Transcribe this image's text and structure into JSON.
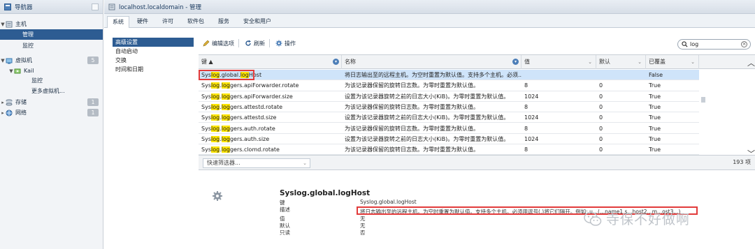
{
  "navigator": {
    "title": "导航器",
    "items": [
      {
        "label": "主机",
        "badge": ""
      },
      {
        "label": "管理",
        "badge": ""
      },
      {
        "label": "监控",
        "badge": ""
      },
      {
        "label": "虚拟机",
        "badge": "5"
      },
      {
        "label": "Kail",
        "badge": ""
      },
      {
        "label": "监控",
        "badge": ""
      },
      {
        "label": "更多虚拟机...",
        "badge": ""
      },
      {
        "label": "存储",
        "badge": "1"
      },
      {
        "label": "网络",
        "badge": "1"
      }
    ]
  },
  "header": {
    "title": "localhost.localdomain - 管理"
  },
  "tabs": [
    {
      "label": "系统"
    },
    {
      "label": "硬件"
    },
    {
      "label": "许可"
    },
    {
      "label": "软件包"
    },
    {
      "label": "服务"
    },
    {
      "label": "安全和用户"
    }
  ],
  "left_menu": [
    {
      "label": "高级设置"
    },
    {
      "label": "自动启动"
    },
    {
      "label": "交换"
    },
    {
      "label": "时间和日期"
    }
  ],
  "toolbar": {
    "edit_label": "编辑选项",
    "refresh_label": "刷新",
    "actions_label": "操作"
  },
  "search": {
    "value": "log",
    "clear_glyph": "×"
  },
  "grid": {
    "columns": [
      {
        "label": "键 ▲"
      },
      {
        "label": "名称"
      },
      {
        "label": "值"
      },
      {
        "label": "默认"
      },
      {
        "label": "已覆盖"
      }
    ],
    "rows": [
      {
        "key_pre": "Sys",
        "key_hl": "log",
        "key_mid": ".global.",
        "key_hl2": "log",
        "key_post": "Host",
        "name": "将日志输出至的远程主机。为空时重置为默认值。支持多个主机。必须...",
        "value": "",
        "default": "",
        "overridden": "False"
      },
      {
        "key_pre": "Sys",
        "key_hl": "log",
        "key_mid": ".",
        "key_hl2": "log",
        "key_post": "gers.apiForwarder.rotate",
        "name": "为该记录器保留的旋转日志数。为零时重置为默认值。",
        "value": "8",
        "default": "0",
        "overridden": "True"
      },
      {
        "key_pre": "Sys",
        "key_hl": "log",
        "key_mid": ".",
        "key_hl2": "log",
        "key_post": "gers.apiForwarder.size",
        "name": "设置为该记录器旋转之前的日志大小(KiB)。为零时重置为默认值。",
        "value": "1024",
        "default": "0",
        "overridden": "True"
      },
      {
        "key_pre": "Sys",
        "key_hl": "log",
        "key_mid": ".",
        "key_hl2": "log",
        "key_post": "gers.attestd.rotate",
        "name": "为该记录器保留的旋转日志数。为零时重置为默认值。",
        "value": "8",
        "default": "0",
        "overridden": "True"
      },
      {
        "key_pre": "Sys",
        "key_hl": "log",
        "key_mid": ".",
        "key_hl2": "log",
        "key_post": "gers.attestd.size",
        "name": "设置为该记录器旋转之前的日志大小(KiB)。为零时重置为默认值。",
        "value": "1024",
        "default": "0",
        "overridden": "True"
      },
      {
        "key_pre": "Sys",
        "key_hl": "log",
        "key_mid": ".",
        "key_hl2": "log",
        "key_post": "gers.auth.rotate",
        "name": "为该记录器保留的旋转日志数。为零时重置为默认值。",
        "value": "8",
        "default": "0",
        "overridden": "True"
      },
      {
        "key_pre": "Sys",
        "key_hl": "log",
        "key_mid": ".",
        "key_hl2": "log",
        "key_post": "gers.auth.size",
        "name": "设置为该记录器旋转之前的日志大小(KiB)。为零时重置为默认值。",
        "value": "1024",
        "default": "0",
        "overridden": "True"
      },
      {
        "key_pre": "Sys",
        "key_hl": "log",
        "key_mid": ".",
        "key_hl2": "log",
        "key_post": "gers.clomd.rotate",
        "name": "为该记录器保留的旋转日志数。为零时重置为默认值。",
        "value": "8",
        "default": "0",
        "overridden": "True"
      }
    ]
  },
  "filter": {
    "placeholder": "快速筛选器...",
    "count": "193 项"
  },
  "details": {
    "title": "Syslog.global.logHost",
    "rows": [
      {
        "label": "键",
        "value": "Syslog.global.logHost"
      },
      {
        "label": "描述",
        "value": "将日志输出至的远程主机。为空时重置为默认值。支持多个主机。必须用逗号(,)将它们隔开。例如: u...(...name1,s...host2...m...ost3...)"
      },
      {
        "label": "值",
        "value": "无"
      },
      {
        "label": "默认",
        "value": "无"
      },
      {
        "label": "只读",
        "value": "否"
      }
    ]
  },
  "watermark": {
    "text": "寺保不好做啊"
  },
  "colors": {
    "accent": "#2d5c92",
    "highlight": "#ffe600",
    "annotation": "#e23b3b"
  }
}
